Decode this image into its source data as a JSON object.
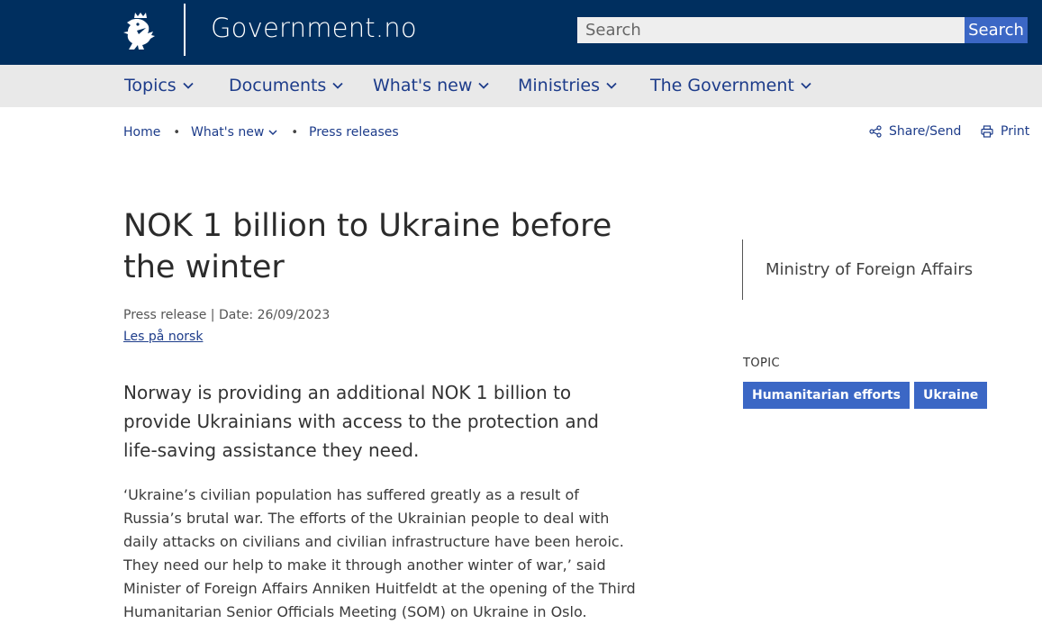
{
  "header": {
    "site_name": "Government.no",
    "logo_icon": "norwegian-lion-coat-of-arms-icon",
    "search": {
      "placeholder": "Search",
      "value": "",
      "button_label": "Search"
    },
    "colors": {
      "background": "#002f5f",
      "search_button": "#3b67c5"
    }
  },
  "nav": {
    "items": [
      {
        "label": "Topics"
      },
      {
        "label": "Documents"
      },
      {
        "label": "What's new"
      },
      {
        "label": "Ministries"
      },
      {
        "label": "The Government"
      }
    ],
    "item_icon": "chevron-down-icon"
  },
  "breadcrumb": {
    "items": [
      {
        "label": "Home"
      },
      {
        "label": "What's new"
      },
      {
        "label": "Press releases"
      }
    ],
    "separator": "•"
  },
  "utility": {
    "share_label": "Share/Send",
    "share_icon": "share-icon",
    "print_label": "Print",
    "print_icon": "printer-icon"
  },
  "article": {
    "title": "NOK 1 billion to Ukraine before the winter",
    "meta": "Press release | Date: 26/09/2023",
    "language_link": "Les på norsk",
    "lead": "Norway is providing an additional NOK 1 billion to provide Ukrainians with access to the protection and life-saving assistance they need.",
    "body": "‘Ukraine’s civilian population has suffered greatly as a result of Russia’s brutal war. The efforts of the Ukrainian people to deal with daily attacks on civilians and civilian infrastructure have been heroic. They need our help to make it through another winter of war,’ said Minister of Foreign Affairs Anniken Huitfeldt at the opening of the Third Humanitarian Senior Officials Meeting (SOM) on Ukraine in Oslo."
  },
  "sidebar": {
    "ministry": "Ministry of Foreign Affairs",
    "topic_label": "TOPIC",
    "tags": [
      {
        "label": "Humanitarian efforts"
      },
      {
        "label": "Ukraine"
      }
    ],
    "tag_color": "#3b67c5"
  }
}
